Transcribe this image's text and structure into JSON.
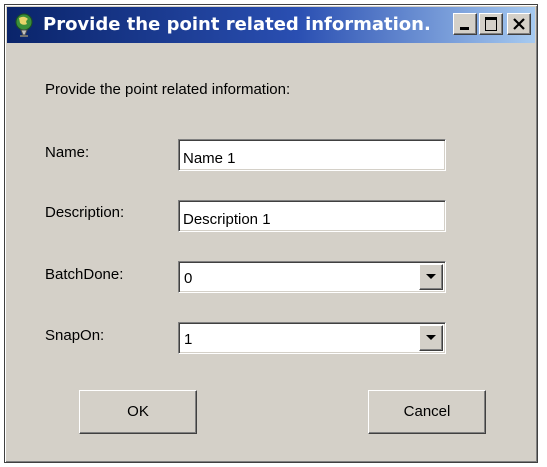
{
  "window": {
    "title": "Provide the point related information."
  },
  "dialog": {
    "prompt": "Provide the point related information:",
    "fields": {
      "name": {
        "label": "Name:",
        "value": "Name 1"
      },
      "description": {
        "label": "Description:",
        "value": "Description 1"
      },
      "batch_done": {
        "label": "BatchDone:",
        "value": "0"
      },
      "snap_on": {
        "label": "SnapOn:",
        "value": "1"
      }
    },
    "buttons": {
      "ok": "OK",
      "cancel": "Cancel"
    }
  },
  "icons": {
    "app": "globe-person-icon",
    "minimize": "minimize-icon",
    "maximize": "maximize-icon",
    "close": "close-icon",
    "dropdown": "chevron-down-icon"
  },
  "colors": {
    "titlebar_start": "#0a246a",
    "titlebar_end": "#a6caf0",
    "dialog_bg": "#d4d0c8"
  }
}
